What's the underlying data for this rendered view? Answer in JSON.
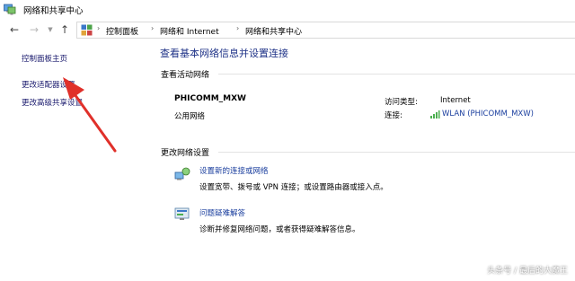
{
  "window": {
    "title": "网络和共享中心"
  },
  "nav": {
    "back_icon": "arrow-left-icon",
    "forward_icon": "arrow-right-icon",
    "up_icon": "arrow-up-icon"
  },
  "address": {
    "crumbs": [
      "控制面板",
      "网络和 Internet",
      "网络和共享中心"
    ]
  },
  "sidebar": {
    "items": [
      {
        "label": "控制面板主页"
      },
      {
        "label": "更改适配器设置"
      },
      {
        "label": "更改高级共享设置"
      }
    ]
  },
  "main": {
    "title": "查看基本网络信息并设置连接",
    "active_section_label": "查看活动网络",
    "network": {
      "name": "PHICOMM_MXW",
      "category": "公用网络",
      "access_type_label": "访问类型:",
      "access_type_value": "Internet",
      "connection_label": "连接:",
      "connection_value": "WLAN (PHICOMM_MXW)"
    },
    "change_section_label": "更改网络设置",
    "tasks": [
      {
        "link": "设置新的连接或网络",
        "desc": "设置宽带、拨号或 VPN 连接；或设置路由器或接入点。",
        "icon": "network-setup-icon"
      },
      {
        "link": "问题疑难解答",
        "desc": "诊断并修复网络问题，或者获得疑难解答信息。",
        "icon": "troubleshoot-icon"
      }
    ]
  },
  "watermark": {
    "text": "头条号 / 最后的大魔王"
  },
  "colors": {
    "title_blue": "#1e3287",
    "link_blue": "#1a3e9e",
    "arrow_red": "#e0302a"
  }
}
